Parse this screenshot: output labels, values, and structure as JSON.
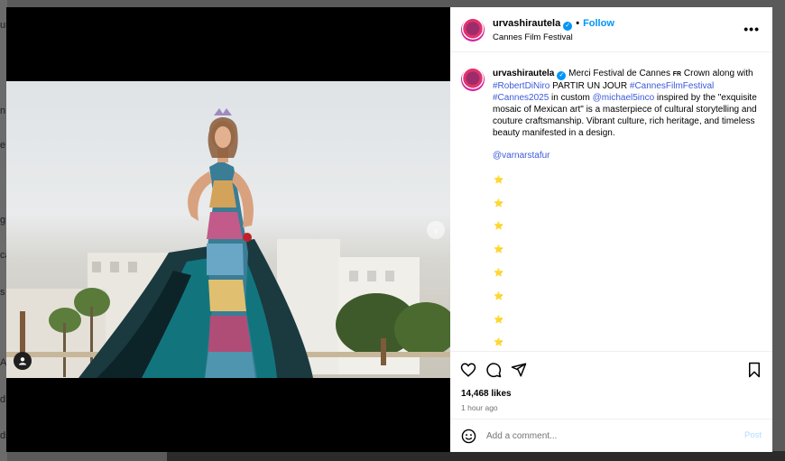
{
  "background": {
    "sidebar_letters": [
      "ur",
      "n",
      "e",
      "",
      "g",
      "ca",
      "s",
      "A",
      "d",
      "ds"
    ]
  },
  "post": {
    "username": "urvashirautela",
    "follow_label": "Follow",
    "separator": "•",
    "location": "Cannes Film Festival",
    "more_label": "•••",
    "caption": {
      "text_1": "Merci Festival de Cannes ",
      "flag": "FR",
      "text_2": " Crown along with ",
      "tag_1": "#RobertDiNiro",
      "text_3": " PARTIR UN JOUR ",
      "tag_2": "#CannesFilmFestival",
      "tag_3": "#Cannes2025",
      "text_4": " in custom ",
      "mention_1": "@michael5inco",
      "text_5": " inspired by the \"exquisite mosaic of Mexican art\" is a masterpiece of cultural storytelling and couture craftsmanship. Vibrant culture, rich heritage, and timeless beauty manifested in a design."
    },
    "mention_2": "@varnarstafur",
    "stars": [
      "⭐",
      "⭐",
      "⭐",
      "⭐",
      "⭐",
      "⭐",
      "⭐",
      "⭐"
    ],
    "likes": "14,468 likes",
    "time_ago": "1 hour ago",
    "comment_placeholder": "Add a comment...",
    "post_label": "Post",
    "next_arrow": "›"
  },
  "colors": {
    "accent": "#0095f6",
    "link": "#3b5bdb",
    "post_disabled": "#b3dbff"
  },
  "icons": [
    "verified-icon",
    "more-icon",
    "heart-icon",
    "comment-icon",
    "share-icon",
    "bookmark-icon",
    "emoji-icon",
    "tag-user-icon",
    "chevron-right-icon"
  ]
}
